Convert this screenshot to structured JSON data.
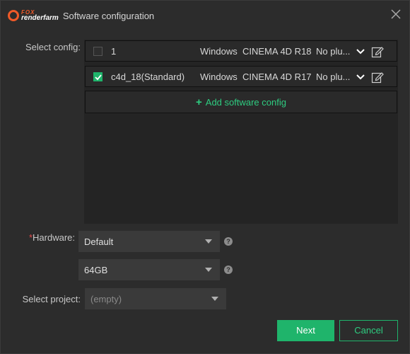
{
  "window": {
    "title": "Software configuration",
    "logo": {
      "top_text": "FOX",
      "bottom_text": "renderfarm"
    }
  },
  "config_section": {
    "label": "Select config:",
    "items": [
      {
        "name": "1",
        "os": "Windows",
        "software": "CINEMA 4D R18",
        "plugin": "No plu...",
        "checked": false
      },
      {
        "name": "c4d_18(Standard)",
        "os": "Windows",
        "software": "CINEMA 4D R17",
        "plugin": "No plu...",
        "checked": true
      }
    ],
    "add_label": "Add software config"
  },
  "hardware": {
    "required_mark": "*",
    "label": "Hardware:",
    "selected": "Default",
    "memory_selected": "64GB"
  },
  "project": {
    "label": "Select project:",
    "selected": "(empty)"
  },
  "buttons": {
    "next": "Next",
    "cancel": "Cancel"
  },
  "colors": {
    "accent": "#1fb46b",
    "accent_text": "#2ecc80",
    "required": "#e24a4a",
    "logo": "#f05a28"
  }
}
